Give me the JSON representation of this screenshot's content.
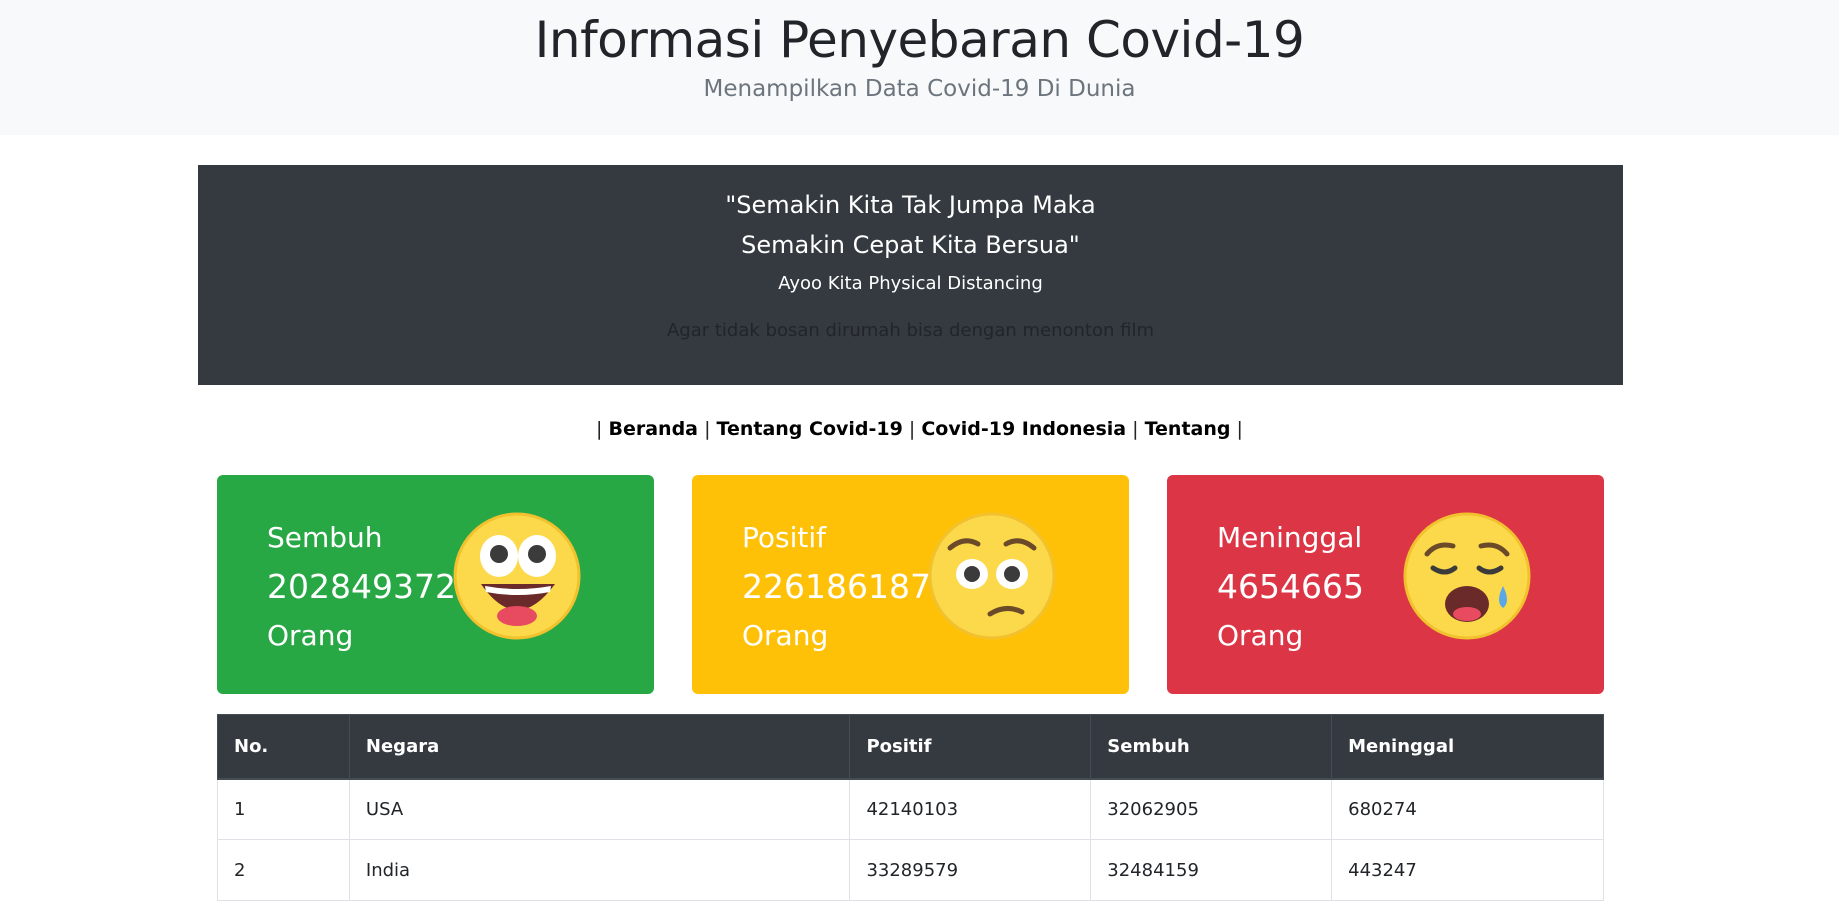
{
  "hero": {
    "title": "Informasi Penyebaran Covid-19",
    "subtitle": "Menampilkan Data Covid-19 Di Dunia"
  },
  "quote": {
    "line1": "\"Semakin Kita Tak Jumpa Maka",
    "line2": "Semakin Cepat Kita Bersua\"",
    "sub": "Ayoo Kita Physical Distancing",
    "note": "Agar tidak bosan dirumah bisa dengan menonton film"
  },
  "nav": {
    "items": [
      "Beranda",
      "Tentang Covid-19",
      "Covid-19 Indonesia",
      "Tentang"
    ],
    "separator": "|"
  },
  "cards": [
    {
      "label": "Sembuh",
      "value": "202849372",
      "unit": "Orang",
      "color": "#28a745",
      "icon": "grinning-face-icon"
    },
    {
      "label": "Positif",
      "value": "226186187",
      "unit": "Orang",
      "color": "#ffc107",
      "icon": "worried-face-icon"
    },
    {
      "label": "Meninggal",
      "value": "4654665",
      "unit": "Orang",
      "color": "#dc3545",
      "icon": "crying-face-icon"
    }
  ],
  "table": {
    "headers": [
      "No.",
      "Negara",
      "Positif",
      "Sembuh",
      "Meninggal"
    ],
    "rows": [
      [
        "1",
        "USA",
        "42140103",
        "32062905",
        "680274"
      ],
      [
        "2",
        "India",
        "33289579",
        "32484159",
        "443247"
      ]
    ]
  }
}
